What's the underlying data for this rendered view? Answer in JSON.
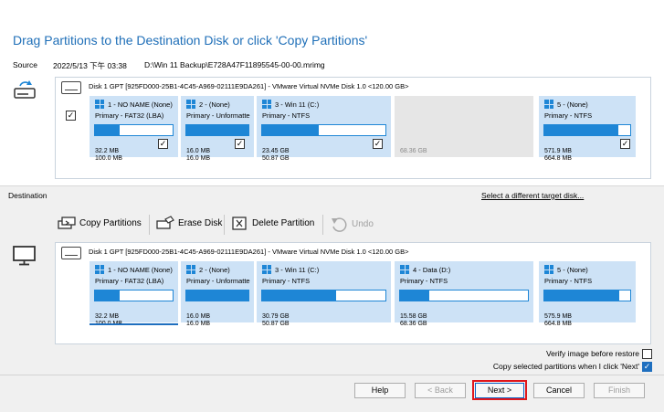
{
  "title": "Drag Partitions to the Destination Disk or click 'Copy Partitions'",
  "source": {
    "label": "Source",
    "date": "2022/5/13 下午 03:38",
    "path": "D:\\Win 11 Backup\\E728A47F11895545-00-00.mrimg",
    "disk_header": "Disk 1 GPT [925FD000-25B1-4C45-A969-02111E9DA261] - VMware Virtual NVMe Disk 1.0  <120.00 GB>",
    "partitions": [
      {
        "name": "1 - NO NAME (None)",
        "type": "Primary - FAT32 (LBA)",
        "used": "32.2 MB",
        "total": "100.0 MB",
        "fill": 0.32
      },
      {
        "name": "2 -  (None)",
        "type": "Primary - Unformatte",
        "used": "16.0 MB",
        "total": "16.0 MB",
        "fill": 1.0
      },
      {
        "name": "3 - Win 11 (C:)",
        "type": "Primary - NTFS",
        "used": "23.45 GB",
        "total": "50.87 GB",
        "fill": 0.46
      },
      {
        "unalloc": "68.36 GB"
      },
      {
        "name": "5 -  (None)",
        "type": "Primary - NTFS",
        "used": "571.9 MB",
        "total": "664.8 MB",
        "fill": 0.86
      }
    ]
  },
  "destination": {
    "label": "Destination",
    "select_link": "Select a different target disk...",
    "toolbar": {
      "copy": "Copy Partitions",
      "erase": "Erase Disk",
      "delete": "Delete Partition",
      "undo": "Undo"
    },
    "disk_header": "Disk 1 GPT [925FD000-25B1-4C45-A969-02111E9DA261] - VMware Virtual NVMe Disk 1.0  <120.00 GB>",
    "partitions": [
      {
        "name": "1 - NO NAME (None)",
        "type": "Primary - FAT32 (LBA)",
        "used": "32.2 MB",
        "total": "100.0 MB",
        "fill": 0.32
      },
      {
        "name": "2 -  (None)",
        "type": "Primary - Unformatte",
        "used": "16.0 MB",
        "total": "16.0 MB",
        "fill": 1.0
      },
      {
        "name": "3 - Win 11 (C:)",
        "type": "Primary - NTFS",
        "used": "30.79 GB",
        "total": "50.87 GB",
        "fill": 0.6
      },
      {
        "name": "4 - Data (D:)",
        "type": "Primary - NTFS",
        "used": "15.58 GB",
        "total": "68.36 GB",
        "fill": 0.23
      },
      {
        "name": "5 -  (None)",
        "type": "Primary - NTFS",
        "used": "575.9 MB",
        "total": "664.8 MB",
        "fill": 0.87
      }
    ]
  },
  "options": {
    "verify": "Verify image before restore",
    "copy_selected": "Copy selected partitions when I click 'Next'"
  },
  "buttons": {
    "help": "Help",
    "back": "< Back",
    "next": "Next >",
    "cancel": "Cancel",
    "finish": "Finish"
  },
  "check_mark": "✓"
}
